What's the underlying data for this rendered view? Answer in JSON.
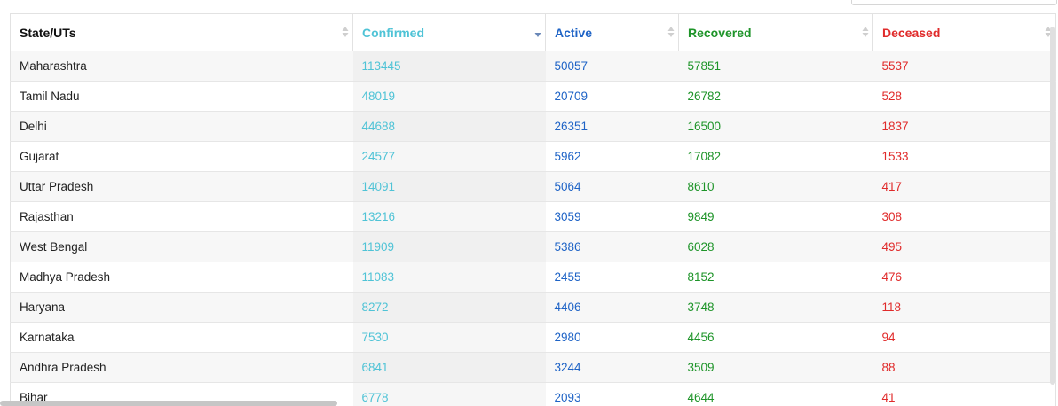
{
  "colors": {
    "confirmed": "#4fc3d6",
    "active": "#1e63c6",
    "recovered": "#1e9429",
    "deceased": "#e02b2b"
  },
  "table": {
    "headers": {
      "state": "State/UTs",
      "confirmed": "Confirmed",
      "active": "Active",
      "recovered": "Recovered",
      "deceased": "Deceased"
    },
    "sort": {
      "column": "confirmed",
      "direction": "descending"
    },
    "rows": [
      {
        "state": "Maharashtra",
        "confirmed": "113445",
        "active": "50057",
        "recovered": "57851",
        "deceased": "5537"
      },
      {
        "state": "Tamil Nadu",
        "confirmed": "48019",
        "active": "20709",
        "recovered": "26782",
        "deceased": "528"
      },
      {
        "state": "Delhi",
        "confirmed": "44688",
        "active": "26351",
        "recovered": "16500",
        "deceased": "1837"
      },
      {
        "state": "Gujarat",
        "confirmed": "24577",
        "active": "5962",
        "recovered": "17082",
        "deceased": "1533"
      },
      {
        "state": "Uttar Pradesh",
        "confirmed": "14091",
        "active": "5064",
        "recovered": "8610",
        "deceased": "417"
      },
      {
        "state": "Rajasthan",
        "confirmed": "13216",
        "active": "3059",
        "recovered": "9849",
        "deceased": "308"
      },
      {
        "state": "West Bengal",
        "confirmed": "11909",
        "active": "5386",
        "recovered": "6028",
        "deceased": "495"
      },
      {
        "state": "Madhya Pradesh",
        "confirmed": "11083",
        "active": "2455",
        "recovered": "8152",
        "deceased": "476"
      },
      {
        "state": "Haryana",
        "confirmed": "8272",
        "active": "4406",
        "recovered": "3748",
        "deceased": "118"
      },
      {
        "state": "Karnataka",
        "confirmed": "7530",
        "active": "2980",
        "recovered": "4456",
        "deceased": "94"
      },
      {
        "state": "Andhra Pradesh",
        "confirmed": "6841",
        "active": "3244",
        "recovered": "3509",
        "deceased": "88"
      },
      {
        "state": "Bihar",
        "confirmed": "6778",
        "active": "2093",
        "recovered": "4644",
        "deceased": "41"
      }
    ]
  }
}
